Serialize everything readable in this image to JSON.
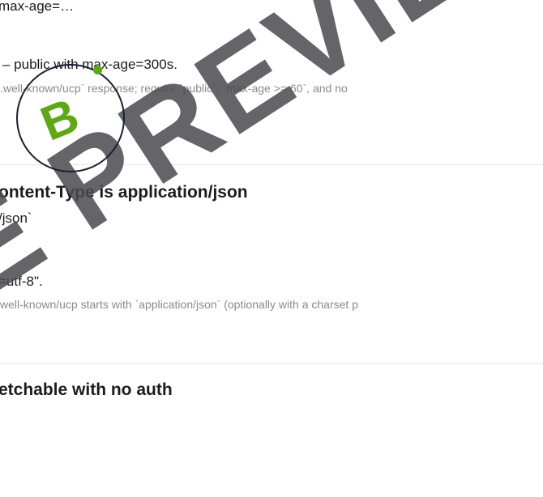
{
  "check_cache": {
    "value_truncated": "max-age=…",
    "result_line": "– public with max-age=300s.",
    "detail": ".well-known/ucp` response; require `public`, `max-age >= 60`, and no"
  },
  "check_content_type": {
    "title": "ontent-Type is application/json",
    "expected": "/json`",
    "observed": "=utf-8\".",
    "detail": "well-known/ucp starts with `application/json` (optionally with a charset p"
  },
  "check_fetchable": {
    "title": "etchable with no auth"
  },
  "watermark": {
    "text": "E PREVIEW",
    "color": "#4b4b50"
  },
  "badge": {
    "letter": "B",
    "ring_color": "#1a1f33",
    "letter_color": "#5ea814"
  }
}
